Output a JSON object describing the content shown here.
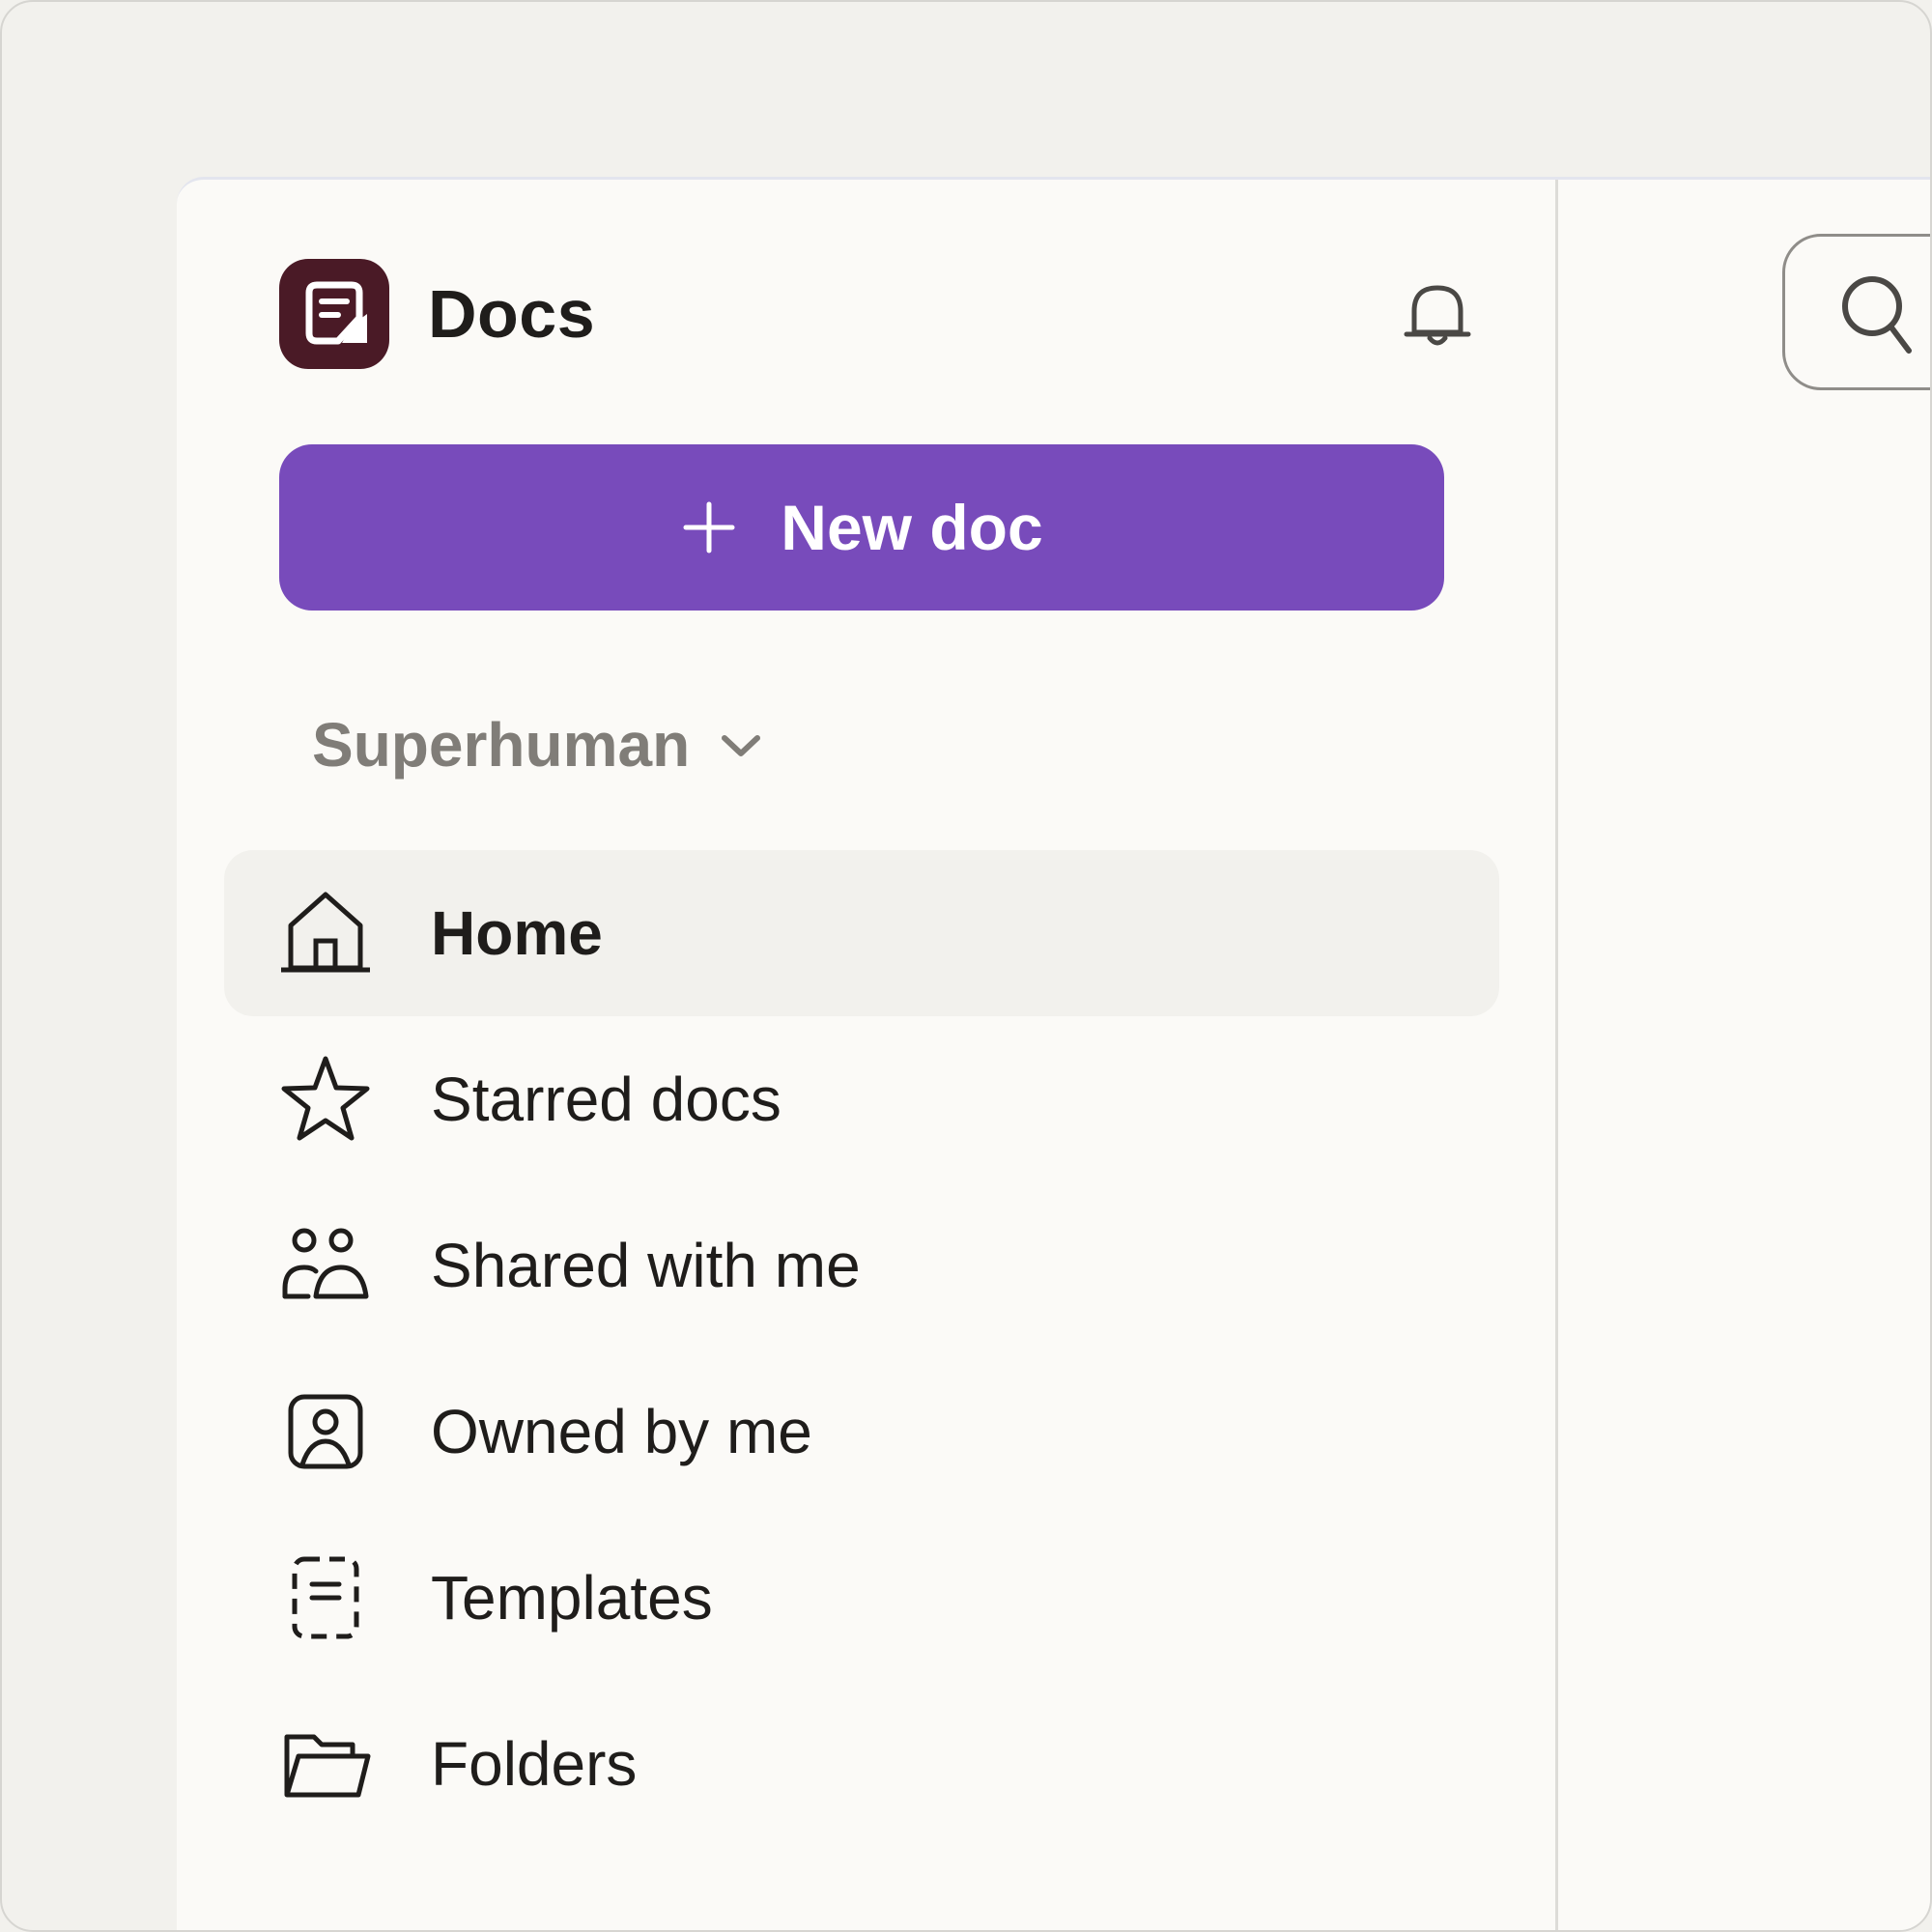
{
  "app": {
    "name": "Docs"
  },
  "icons": {
    "logo": "docs-logo-icon",
    "bell": "bell-icon",
    "plus": "plus-icon",
    "chevron": "chevron-down-icon",
    "search": "search-icon"
  },
  "colors": {
    "logo_bg": "#4a1a26",
    "primary": "#784bbb",
    "active_bg": "#f2f1ed",
    "text": "#1f1d1b",
    "muted_text": "#807d78"
  },
  "sidebar": {
    "new_doc_label": "New doc",
    "workspace_label": "Superhuman",
    "items": [
      {
        "label": "Home",
        "icon": "home-icon",
        "active": true
      },
      {
        "label": "Starred docs",
        "icon": "star-icon",
        "active": false
      },
      {
        "label": "Shared with me",
        "icon": "people-icon",
        "active": false
      },
      {
        "label": "Owned by me",
        "icon": "user-portrait-icon",
        "active": false
      },
      {
        "label": "Templates",
        "icon": "template-icon",
        "active": false
      },
      {
        "label": "Folders",
        "icon": "folder-icon",
        "active": false
      }
    ]
  }
}
